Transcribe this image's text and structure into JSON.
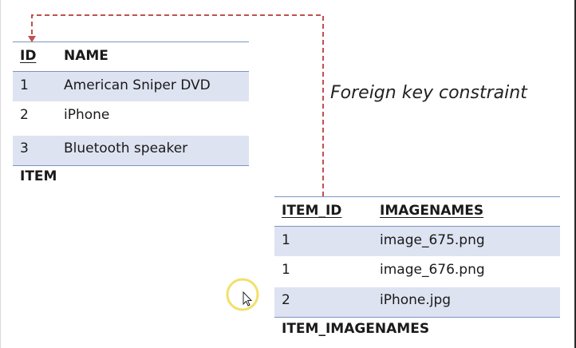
{
  "fk_label": "Foreign key constraint",
  "item_table": {
    "headers": {
      "id": "ID",
      "name": "NAME"
    },
    "rows": [
      {
        "id": "1",
        "name": "American Sniper DVD"
      },
      {
        "id": "2",
        "name": "iPhone"
      },
      {
        "id": "3",
        "name": "Bluetooth speaker"
      }
    ],
    "caption": "ITEM"
  },
  "images_table": {
    "headers": {
      "item_id": "ITEM_ID",
      "imagenames": "IMAGENAMES"
    },
    "rows": [
      {
        "item_id": "1",
        "imagename": "image_675.png"
      },
      {
        "item_id": "1",
        "imagename": "image_676.png"
      },
      {
        "item_id": "2",
        "imagename": "iPhone.jpg"
      }
    ],
    "caption": "ITEM_IMAGENAMES"
  },
  "colors": {
    "row_shade": "#dde3f1",
    "rule": "#7f93c2",
    "arrow": "#c0504d",
    "cursor_ring": "#f2e06b"
  }
}
